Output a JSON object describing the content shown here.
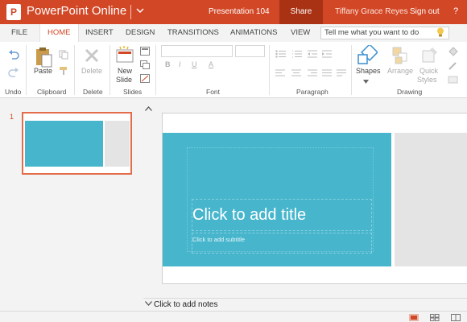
{
  "titlebar": {
    "app_name": "PowerPoint Online",
    "logo_letter": "P",
    "document_name": "Presentation 104",
    "share_label": "Share",
    "user_name": "Tiffany Grace Reyes",
    "signout_label": "Sign out",
    "help_label": "?",
    "brand_color": "#d24726"
  },
  "tabs": [
    {
      "label": "FILE"
    },
    {
      "label": "HOME",
      "active": true
    },
    {
      "label": "INSERT"
    },
    {
      "label": "DESIGN"
    },
    {
      "label": "TRANSITIONS"
    },
    {
      "label": "ANIMATIONS"
    },
    {
      "label": "VIEW"
    }
  ],
  "tellme": {
    "placeholder": "Tell me what you want to do"
  },
  "ribbon": {
    "groups": {
      "undo": "Undo",
      "clipboard": "Clipboard",
      "delete": "Delete",
      "slides": "Slides",
      "font": "Font",
      "paragraph": "Paragraph",
      "drawing": "Drawing"
    },
    "buttons": {
      "paste": "Paste",
      "delete": "Delete",
      "new_slide_1": "New",
      "new_slide_2": "Slide",
      "shapes": "Shapes",
      "arrange": "Arrange",
      "quick_styles_1": "Quick",
      "quick_styles_2": "Styles"
    },
    "format": {
      "bold": "B",
      "italic": "I",
      "underline": "U",
      "font_color": "A"
    }
  },
  "slides_pane": {
    "thumbnails": [
      {
        "number": "1"
      }
    ]
  },
  "slide": {
    "title_placeholder": "Click to add title",
    "subtitle_placeholder": "Click to add subtitle",
    "accent_color": "#47b6cd",
    "panel_color": "#e4e4e4"
  },
  "notes": {
    "label": "Click to add notes"
  }
}
